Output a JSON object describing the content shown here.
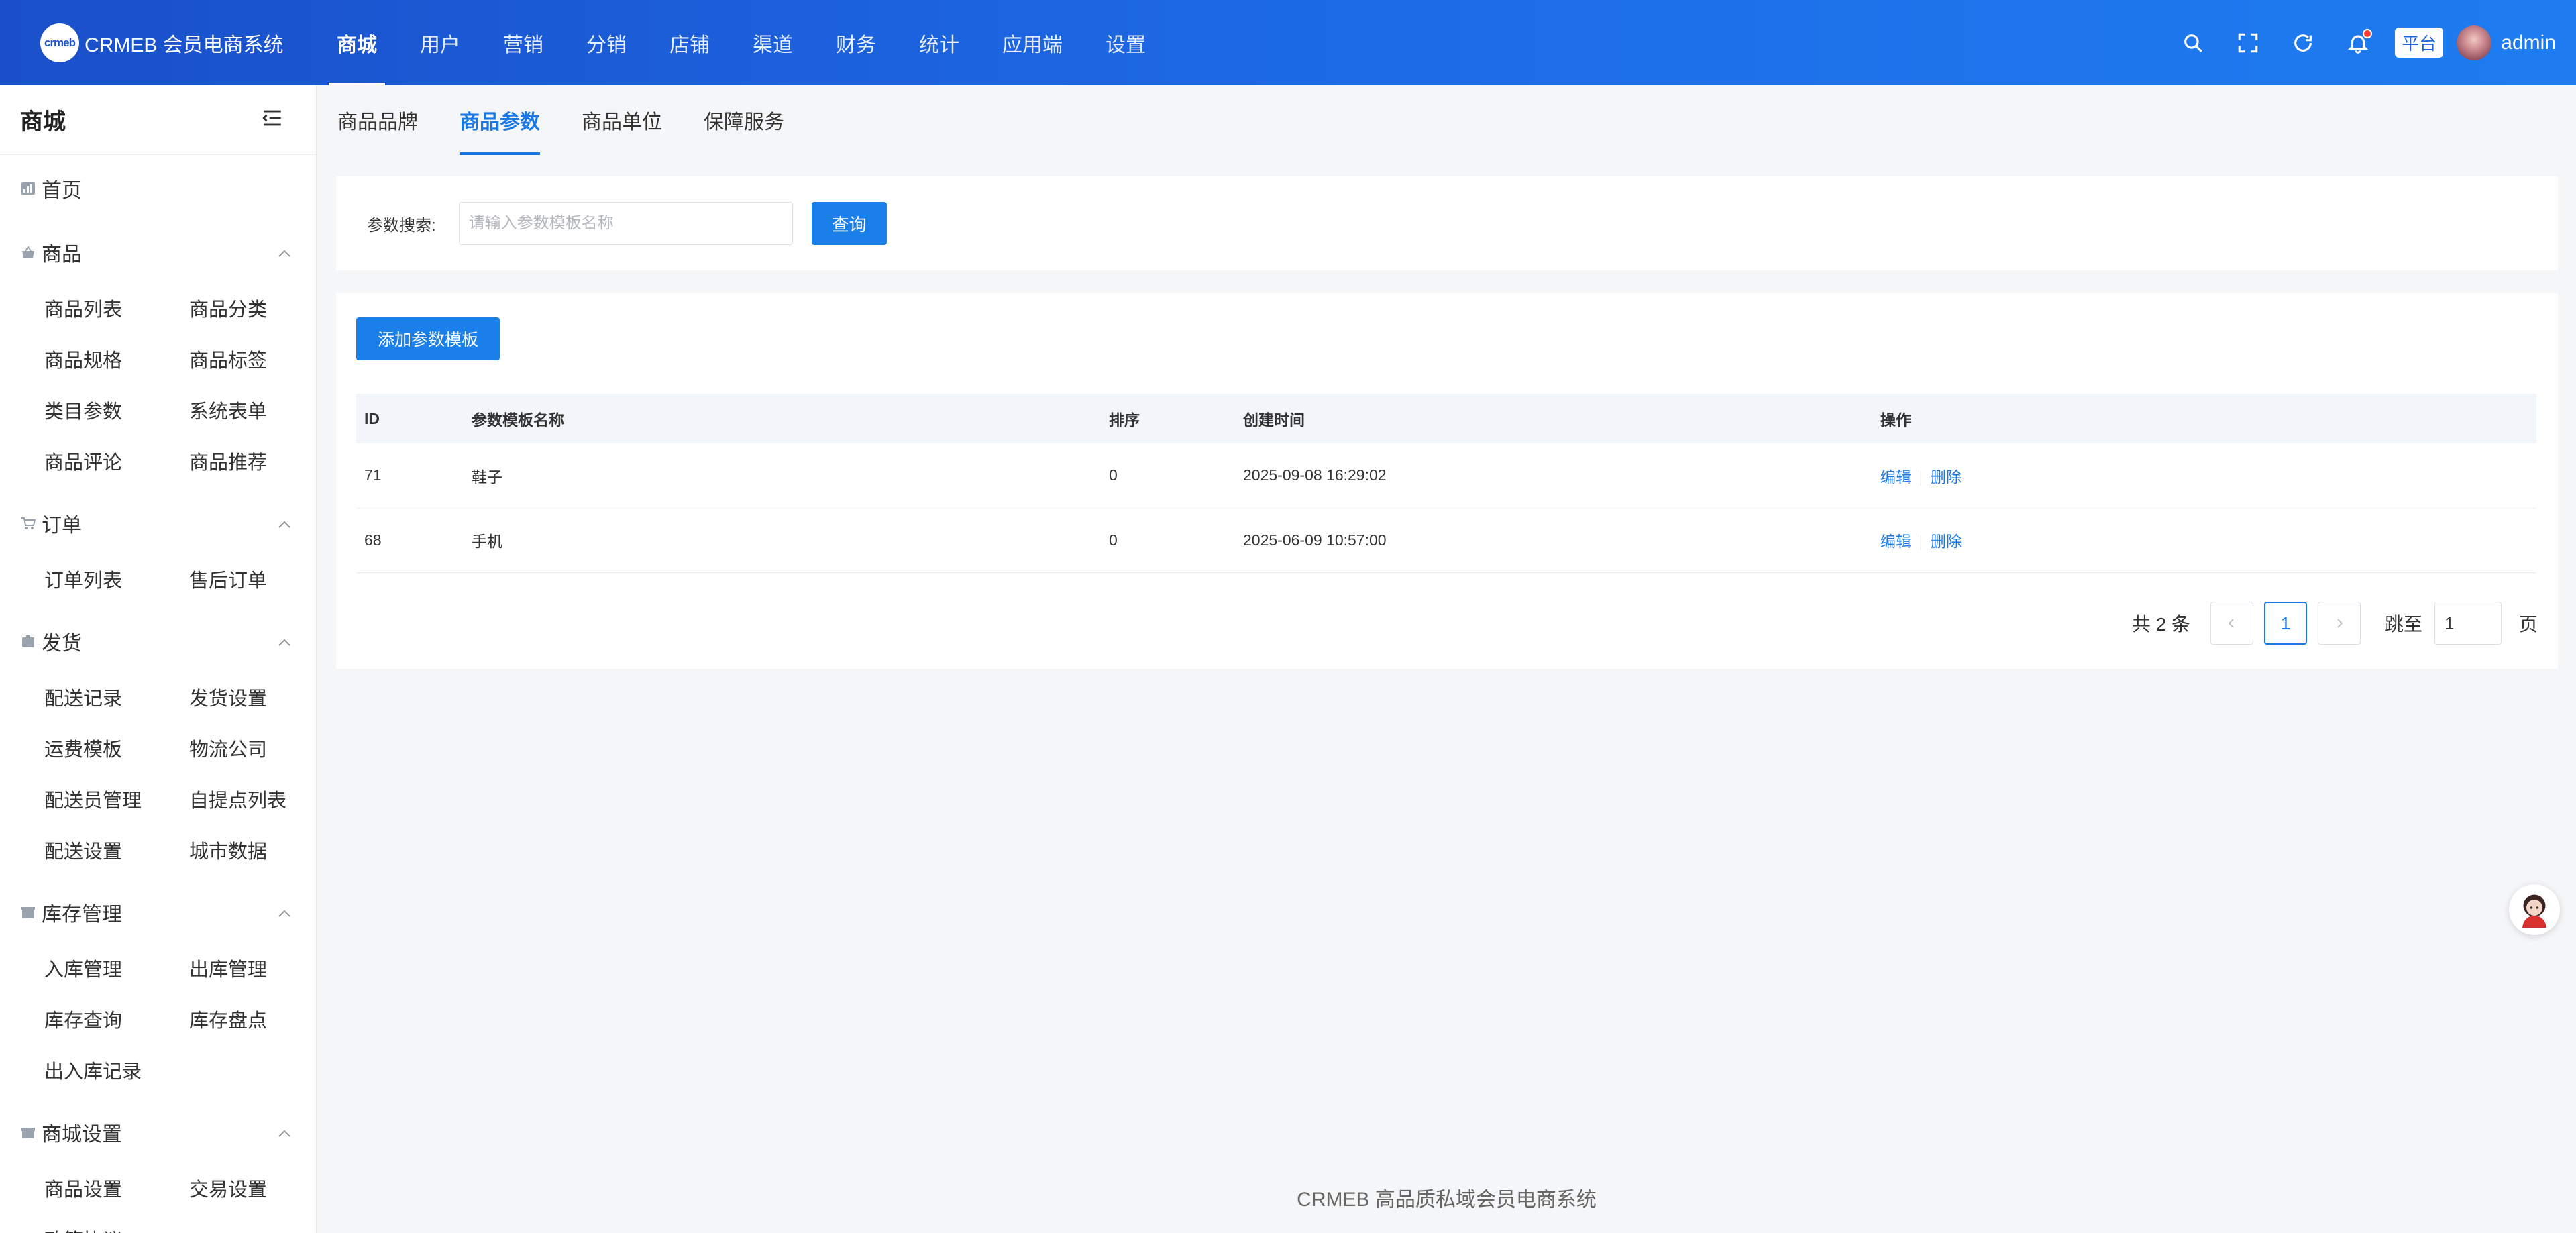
{
  "brand": {
    "logo_text": "crmeb",
    "name": "CRMEB 会员电商系统"
  },
  "topnav": [
    "商城",
    "用户",
    "营销",
    "分销",
    "店铺",
    "渠道",
    "财务",
    "统计",
    "应用端",
    "设置"
  ],
  "header": {
    "platform_label": "平台",
    "username": "admin"
  },
  "sidebar": {
    "title": "商城",
    "home": "首页",
    "groups": [
      {
        "label": "商品",
        "items": [
          "商品列表",
          "商品分类",
          "商品规格",
          "商品标签",
          "类目参数",
          "系统表单",
          "商品评论",
          "商品推荐"
        ]
      },
      {
        "label": "订单",
        "items": [
          "订单列表",
          "售后订单"
        ]
      },
      {
        "label": "发货",
        "items": [
          "配送记录",
          "发货设置",
          "运费模板",
          "物流公司",
          "配送员管理",
          "自提点列表",
          "配送设置",
          "城市数据"
        ]
      },
      {
        "label": "库存管理",
        "items": [
          "入库管理",
          "出库管理",
          "库存查询",
          "库存盘点",
          "出入库记录"
        ]
      },
      {
        "label": "商城设置",
        "items": [
          "商品设置",
          "交易设置",
          "政策协议"
        ]
      }
    ]
  },
  "tabs": [
    "商品品牌",
    "商品参数",
    "商品单位",
    "保障服务"
  ],
  "search": {
    "label": "参数搜索:",
    "placeholder": "请输入参数模板名称",
    "button": "查询"
  },
  "table": {
    "add_button": "添加参数模板",
    "columns": [
      "ID",
      "参数模板名称",
      "排序",
      "创建时间",
      "操作"
    ],
    "rows": [
      {
        "id": "71",
        "name": "鞋子",
        "sort": "0",
        "created": "2025-09-08 16:29:02",
        "edit": "编辑",
        "delete": "删除"
      },
      {
        "id": "68",
        "name": "手机",
        "sort": "0",
        "created": "2025-06-09 10:57:00",
        "edit": "编辑",
        "delete": "删除"
      }
    ]
  },
  "pagination": {
    "total": "共 2 条",
    "current": "1",
    "jump_label": "跳至",
    "jump_value": "1",
    "page_suffix": "页"
  },
  "footer": "CRMEB 高品质私域会员电商系统"
}
